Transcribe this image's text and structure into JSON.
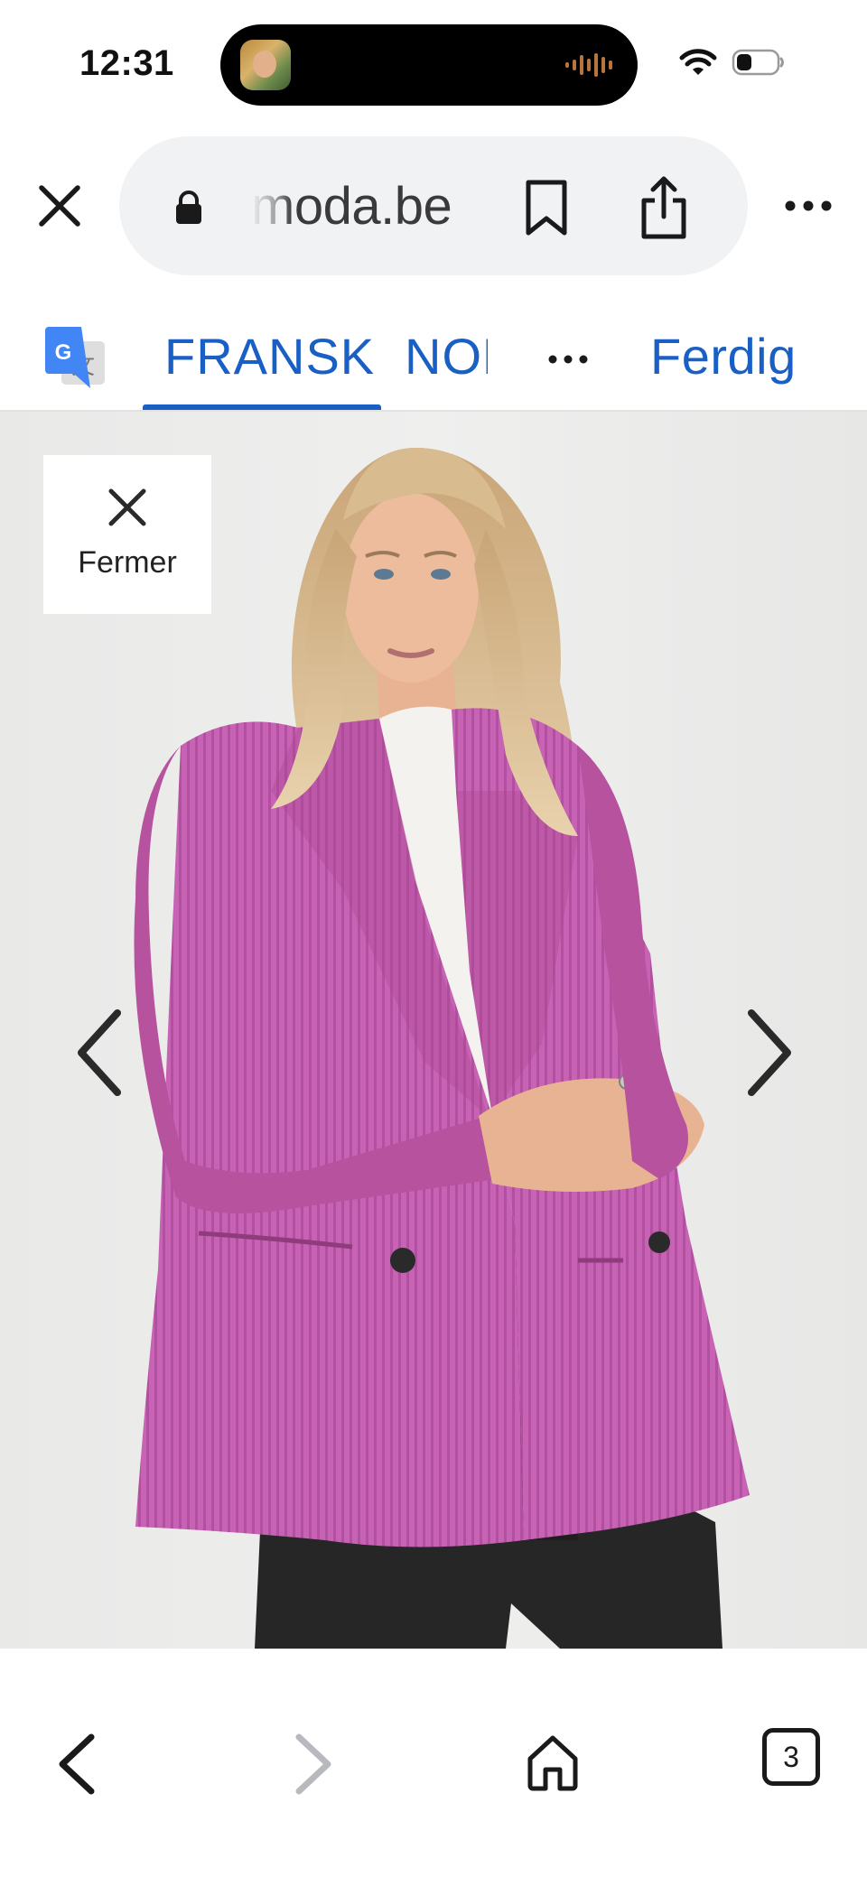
{
  "status_bar": {
    "time": "12:31",
    "icons": [
      "wifi-icon",
      "battery-icon"
    ]
  },
  "browser": {
    "url": "moda.be",
    "icons": [
      "close-icon",
      "lock-icon",
      "bookmark-icon",
      "share-icon",
      "more-icon"
    ]
  },
  "translate_bar": {
    "tabs": [
      {
        "label": "FRANSK",
        "selected": true
      },
      {
        "label": "NORSK",
        "selected": false
      }
    ],
    "done_label": "Ferdig",
    "icons": [
      "google-translate-icon",
      "more-icon"
    ]
  },
  "viewer": {
    "close_label": "Fermer",
    "icons": [
      "close-icon",
      "chevron-left-icon",
      "chevron-right-icon"
    ],
    "image": "model wearing pink corduroy double-breasted blazer"
  },
  "bottom_nav": {
    "tab_count": "3",
    "icons": [
      "back-arrow-icon",
      "forward-arrow-icon",
      "home-icon",
      "tabs-icon"
    ]
  },
  "colors": {
    "accent": "#1a5fc4",
    "url_bar_bg": "#f1f2f4",
    "viewer_bg": "#eeeeed",
    "blazer": "#c45fb0"
  }
}
